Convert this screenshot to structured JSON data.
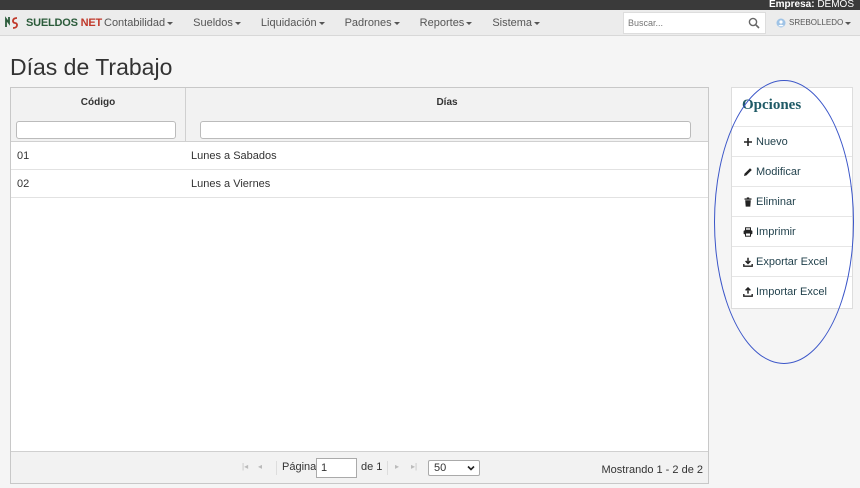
{
  "topbar": {
    "company_label": "Empresa:",
    "company_value": "DEMOS"
  },
  "brand": {
    "name_a": "SUELDOS ",
    "name_b": "NET"
  },
  "nav": {
    "items": [
      {
        "label": "Contabilidad"
      },
      {
        "label": "Sueldos"
      },
      {
        "label": "Liquidación"
      },
      {
        "label": "Padrones"
      },
      {
        "label": "Reportes"
      },
      {
        "label": "Sistema"
      }
    ],
    "search_placeholder": "Buscar...",
    "user": "SREBOLLEDO"
  },
  "page": {
    "title": "Días de Trabajo"
  },
  "grid": {
    "columns": [
      {
        "label": "Código"
      },
      {
        "label": "Días"
      }
    ],
    "rows": [
      {
        "codigo": "01",
        "dias": "Lunes a Sabados"
      },
      {
        "codigo": "02",
        "dias": "Lunes a Viernes"
      }
    ],
    "pager": {
      "page_label": "Página",
      "page_value": "1",
      "of_label": "de 1",
      "page_size": "50",
      "summary": "Mostrando 1 - 2 de 2"
    }
  },
  "options": {
    "title": "Opciones",
    "items": [
      {
        "label": "Nuevo",
        "icon": "plus-icon"
      },
      {
        "label": "Modificar",
        "icon": "pencil-icon"
      },
      {
        "label": "Eliminar",
        "icon": "trash-icon"
      },
      {
        "label": "Imprimir",
        "icon": "printer-icon"
      },
      {
        "label": "Exportar Excel",
        "icon": "download-icon"
      },
      {
        "label": "Importar Excel",
        "icon": "upload-icon"
      }
    ]
  },
  "colors": {
    "brand_green": "#2b5b3a",
    "brand_red": "#c0392b",
    "options_title": "#1f5a66",
    "annotation": "#3a55c8"
  }
}
